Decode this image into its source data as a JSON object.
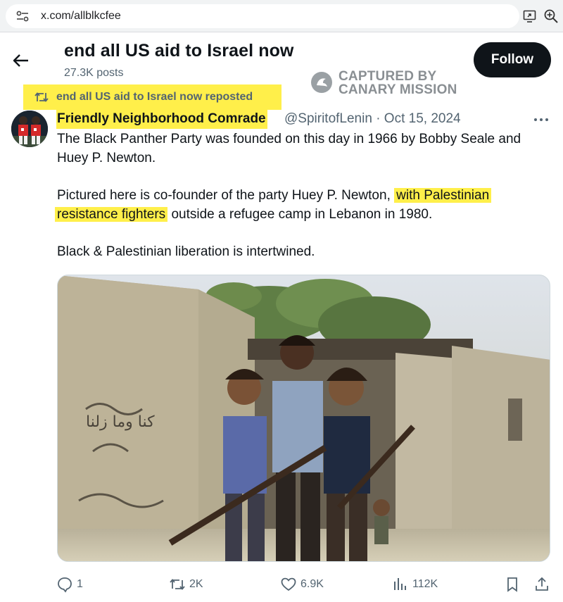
{
  "browser": {
    "url": "x.com/allblkcfee",
    "icons": [
      "site-info-icon",
      "cast-icon",
      "zoom-icon"
    ]
  },
  "profile": {
    "title": "end all US aid to Israel now",
    "post_count": "27.3K posts",
    "follow_label": "Follow"
  },
  "watermark": {
    "line1": "CAPTURED BY",
    "line2": "CANARY MISSION"
  },
  "repost": {
    "text": "end all US aid to Israel now reposted",
    "highlight_color": "#ffef4a"
  },
  "tweet": {
    "author_name": "Friendly Neighborhood Comrade",
    "author_handle_date": "@SpiritofLenin · Oct 15, 2024",
    "para1": "The Black Panther Party was founded on this day in 1966 by Bobby Seale and Huey P. Newton.",
    "para2_before": "Pictured here is co-founder of the  party Huey P. Newton,",
    "para2_highlight1": "with Palestinian",
    "para2_highlight2": "resistance fighters",
    "para2_after": "outside a refugee camp in Lebanon in 1980.",
    "para3": "Black & Palestinian liberation is intertwined.",
    "photo_text": "كنا وما زلنا",
    "actions": {
      "replies": "1",
      "reposts": "2K",
      "likes": "6.9K",
      "views": "112K"
    }
  },
  "colors": {
    "accent_text": "#0f1419",
    "muted_text": "#536471",
    "highlight": "#ffef4a",
    "follow_bg": "#0f1419"
  }
}
